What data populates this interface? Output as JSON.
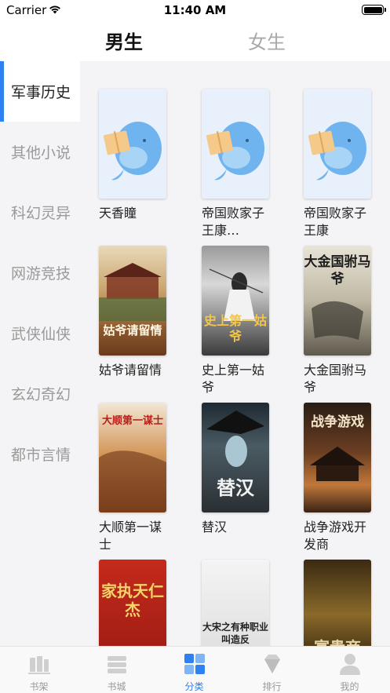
{
  "status_bar": {
    "carrier": "Carrier",
    "time": "11:40 AM"
  },
  "top_tabs": [
    {
      "label": "男生",
      "active": true
    },
    {
      "label": "女生",
      "active": false
    }
  ],
  "sidebar": {
    "items": [
      {
        "label": "军事历史",
        "active": true
      },
      {
        "label": "其他小说"
      },
      {
        "label": "科幻灵异"
      },
      {
        "label": "网游竞技"
      },
      {
        "label": "武侠仙侠"
      },
      {
        "label": "玄幻奇幻"
      },
      {
        "label": "都市言情"
      }
    ]
  },
  "books": [
    {
      "title": "天香瞳",
      "cover": "placeholder"
    },
    {
      "title": "帝国败家子王康…",
      "cover": "placeholder"
    },
    {
      "title": "帝国败家子王康",
      "cover": "placeholder"
    },
    {
      "title": "姑爷请留情",
      "cover_text": "姑爷请留情"
    },
    {
      "title": "史上第一姑爷",
      "cover_text": "史上第一姑爷"
    },
    {
      "title": "大金国驸马爷",
      "cover_text": "大金国驸马爷"
    },
    {
      "title": "大顺第一谋士",
      "cover_text": "大顺第一谋士"
    },
    {
      "title": "替汉",
      "cover_text": "替汉"
    },
    {
      "title": "战争游戏开发商",
      "cover_text": "战争游戏"
    },
    {
      "title": "",
      "cover_text": "家执天仁杰"
    },
    {
      "title": "",
      "cover_text": "大宋之有种职业叫造反"
    },
    {
      "title": "",
      "cover_text": "富贵商"
    }
  ],
  "tab_bar": {
    "items": [
      {
        "label": "书架",
        "icon": "bookshelf-icon"
      },
      {
        "label": "书城",
        "icon": "bookstore-icon"
      },
      {
        "label": "分类",
        "icon": "category-icon",
        "active": true
      },
      {
        "label": "排行",
        "icon": "diamond-icon"
      },
      {
        "label": "我的",
        "icon": "profile-icon"
      }
    ]
  },
  "colors": {
    "accent": "#2f80f0",
    "sidebar_bg": "#f4f4f6",
    "inactive_text": "#9a9a9a"
  }
}
